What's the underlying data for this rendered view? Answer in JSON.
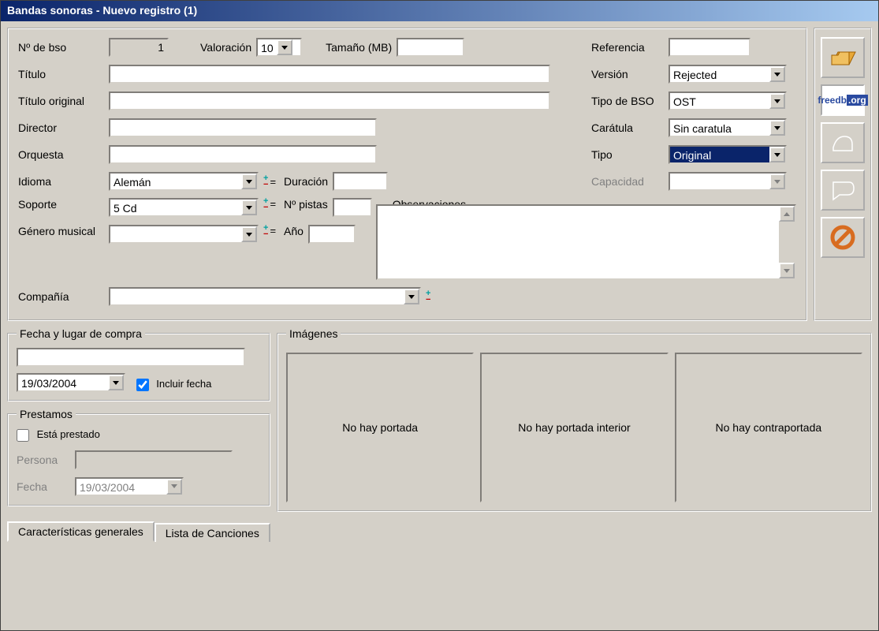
{
  "title": "Bandas sonoras - Nuevo registro (1)",
  "form": {
    "num_bso_lbl": "Nº de bso",
    "num_bso_val": "1",
    "valoracion_lbl": "Valoración",
    "valoracion_val": "10",
    "tamano_lbl": "Tamaño (MB)",
    "tamano_val": "",
    "titulo_lbl": "Título",
    "titulo_val": "",
    "titulo_orig_lbl": "Título original",
    "titulo_orig_val": "",
    "director_lbl": "Director",
    "director_val": "",
    "orquesta_lbl": "Orquesta",
    "orquesta_val": "",
    "idioma_lbl": "Idioma",
    "idioma_val": "Alemán",
    "duracion_lbl": "Duración",
    "duracion_val": "",
    "soporte_lbl": "Soporte",
    "soporte_val": "5 Cd",
    "pistas_lbl": "Nº pistas",
    "pistas_val": "",
    "genero_lbl": "Género musical",
    "genero_val": "",
    "ano_lbl": "Año",
    "ano_val": "",
    "compania_lbl": "Compañía",
    "compania_val": "",
    "observ_lbl": "Observaciones"
  },
  "right": {
    "referencia_lbl": "Referencia",
    "referencia_val": "",
    "version_lbl": "Versión",
    "version_val": "Rejected",
    "tipo_bso_lbl": "Tipo de BSO",
    "tipo_bso_val": "OST",
    "caratula_lbl": "Carátula",
    "caratula_val": "Sin caratula",
    "tipo_lbl": "Tipo",
    "tipo_val": "Original",
    "capacidad_lbl": "Capacidad",
    "capacidad_val": ""
  },
  "compra": {
    "legend": "Fecha y lugar de compra",
    "lugar": "",
    "fecha": "19/03/2004",
    "incluir_lbl": "Incluir fecha"
  },
  "prestamos": {
    "legend": "Prestamos",
    "esta_lbl": "Está prestado",
    "persona_lbl": "Persona",
    "persona_val": "",
    "fecha_lbl": "Fecha",
    "fecha_val": "19/03/2004"
  },
  "images": {
    "legend": "Imágenes",
    "front": "No hay portada",
    "inner": "No hay portada interior",
    "back": "No hay contraportada"
  },
  "tabs": {
    "general": "Características generales",
    "songs": "Lista de Canciones"
  },
  "side": {
    "freedb": "freedb.org"
  }
}
